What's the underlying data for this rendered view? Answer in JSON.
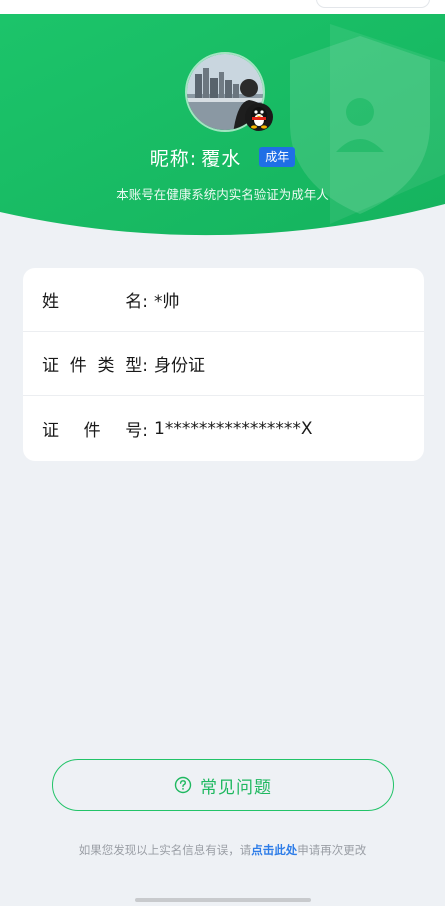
{
  "profile": {
    "nickname_label": "昵称:",
    "nickname_value": "覆水",
    "adult_badge": "成年",
    "verification_note": "本账号在健康系统内实名验证为成年人"
  },
  "info_card": {
    "rows": [
      {
        "label_chars": [
          "姓",
          "名:"
        ],
        "value": "*帅"
      },
      {
        "label_chars": [
          "证",
          "件",
          "类",
          "型:"
        ],
        "value": "身份证"
      },
      {
        "label_chars": [
          "证",
          "件",
          "号:"
        ],
        "value": "1****************X"
      }
    ]
  },
  "faq": {
    "label": "常见问题"
  },
  "footer": {
    "prefix": "如果您发现以上实名信息有误，请",
    "link": "点击此处",
    "suffix": "申请再次更改"
  },
  "colors": {
    "brand_green": "#1fb860",
    "badge_blue": "#1f6fe6",
    "link_blue": "#2e7de8"
  }
}
